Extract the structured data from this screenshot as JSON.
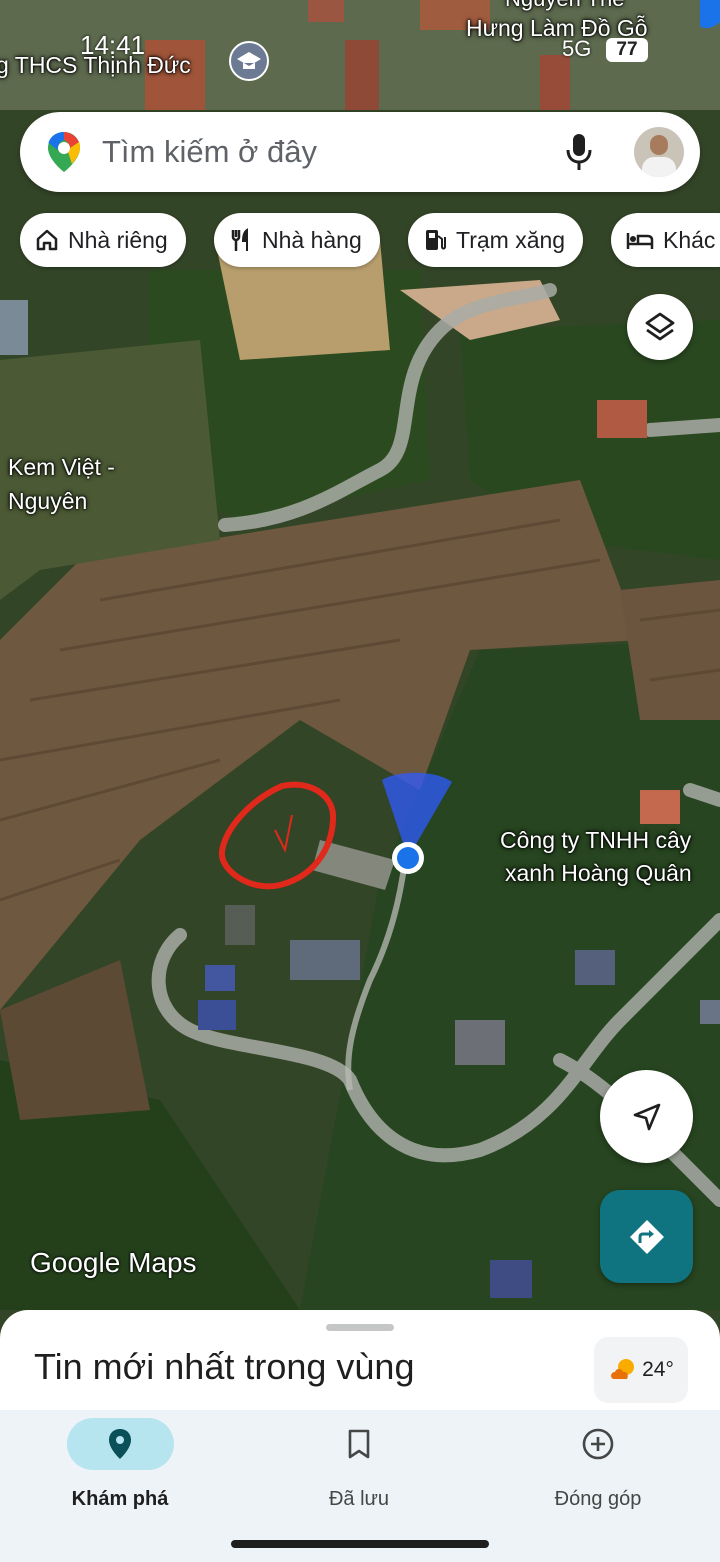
{
  "status_bar": {
    "time": "14:41",
    "network": "5G",
    "battery": "77"
  },
  "map": {
    "labels": {
      "school": "g THCS Thịnh Đức",
      "business_top_line1": "Nguyễn Thế",
      "business_top_line2": "Hưng Làm Đồ Gỗ",
      "kem_viet_line1": "Kem Việt -",
      "kem_viet_line2": "Nguyên",
      "company_line1": "Công ty TNHH cây",
      "company_line2": "xanh Hoàng Quân"
    },
    "logo": "Google Maps"
  },
  "search": {
    "placeholder": "Tìm kiếm ở đây"
  },
  "chips": [
    {
      "label": "Nhà riêng",
      "icon": "home-icon"
    },
    {
      "label": "Nhà hàng",
      "icon": "restaurant-icon"
    },
    {
      "label": "Trạm xăng",
      "icon": "gas-station-icon"
    },
    {
      "label": "Khác",
      "icon": "hotel-icon"
    }
  ],
  "sheet": {
    "title": "Tin mới nhất trong vùng",
    "weather": "24°"
  },
  "nav": {
    "explore": "Khám phá",
    "saved": "Đã lưu",
    "contribute": "Đóng góp"
  },
  "colors": {
    "accent": "#0f7480",
    "active_pill": "#b6e5ef",
    "location_dot": "#1a73e8",
    "annotation": "#e0281b"
  }
}
